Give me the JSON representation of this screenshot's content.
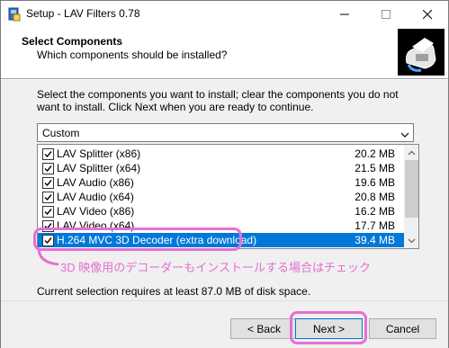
{
  "window": {
    "title": "Setup - LAV Filters 0.78",
    "minimize_glyph": "—",
    "maximize_glyph": "☐",
    "close_glyph": "✕"
  },
  "header": {
    "title": "Select Components",
    "subtitle": "Which components should be installed?"
  },
  "description": "Select the components you want to install; clear the components you do not want to install. Click Next when you are ready to continue.",
  "setup_type": {
    "selected": "Custom"
  },
  "components": [
    {
      "label": "LAV Splitter (x86)",
      "size": "20.2 MB",
      "checked": true,
      "selected": false
    },
    {
      "label": "LAV Splitter (x64)",
      "size": "21.5 MB",
      "checked": true,
      "selected": false
    },
    {
      "label": "LAV Audio (x86)",
      "size": "19.6 MB",
      "checked": true,
      "selected": false
    },
    {
      "label": "LAV Audio (x64)",
      "size": "20.8 MB",
      "checked": true,
      "selected": false
    },
    {
      "label": "LAV Video (x86)",
      "size": "16.2 MB",
      "checked": true,
      "selected": false
    },
    {
      "label": "LAV Video (x64)",
      "size": "17.7 MB",
      "checked": true,
      "selected": false
    },
    {
      "label": "H.264 MVC 3D Decoder (extra download)",
      "size": "39.4 MB",
      "checked": true,
      "selected": true
    }
  ],
  "annotation": "3D 映像用のデコーダーもインストールする場合はチェック",
  "requirement": "Current selection requires at least 87.0 MB of disk space.",
  "buttons": {
    "back": "< Back",
    "next": "Next >",
    "cancel": "Cancel"
  },
  "colors": {
    "selection": "#0078d7",
    "annotation": "#e86fd3"
  }
}
